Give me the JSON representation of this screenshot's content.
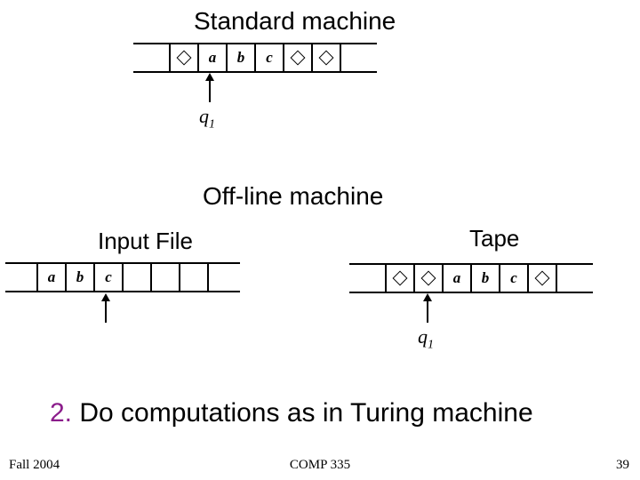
{
  "titles": {
    "standard": "Standard machine",
    "offline": "Off-line machine",
    "input_file": "Input File",
    "tape": "Tape"
  },
  "step": {
    "number": "2.",
    "text": "Do computations as in Turing machine"
  },
  "footer": {
    "left": "Fall 2004",
    "center": "COMP 335",
    "right": "39"
  },
  "states": {
    "q1_top": "q",
    "q1_top_sub": "1",
    "q1_bottom": "q",
    "q1_bottom_sub": "1"
  },
  "tapes": {
    "standard": [
      "blank",
      "a",
      "b",
      "c",
      "blank",
      "blank"
    ],
    "input_file": [
      "a",
      "b",
      "c",
      "",
      "",
      ""
    ],
    "tape2": [
      "blank",
      "blank",
      "a",
      "b",
      "c",
      "blank"
    ]
  },
  "symbols": {
    "a": "a",
    "b": "b",
    "c": "c"
  }
}
